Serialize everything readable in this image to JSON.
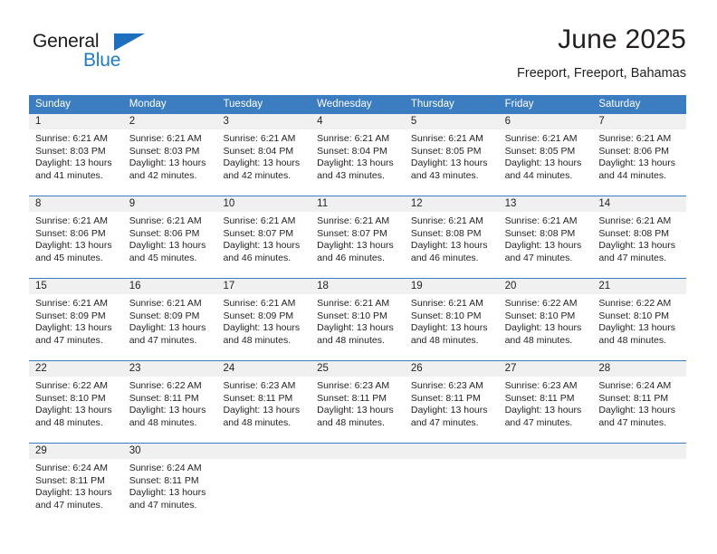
{
  "brand": {
    "name_primary": "General",
    "name_secondary": "Blue",
    "triangle_color": "#1f6fc0",
    "secondary_color": "#1f7cc4"
  },
  "header": {
    "title": "June 2025",
    "subtitle": "Freeport, Freeport, Bahamas"
  },
  "theme": {
    "header_blue": "#3c7cc0",
    "day_band_gray": "#f0f0f0",
    "text": "#231f20"
  },
  "weekdays": [
    "Sunday",
    "Monday",
    "Tuesday",
    "Wednesday",
    "Thursday",
    "Friday",
    "Saturday"
  ],
  "weeks": [
    [
      {
        "day": "1",
        "sunrise": "Sunrise: 6:21 AM",
        "sunset": "Sunset: 8:03 PM",
        "daylight1": "Daylight: 13 hours",
        "daylight2": "and 41 minutes."
      },
      {
        "day": "2",
        "sunrise": "Sunrise: 6:21 AM",
        "sunset": "Sunset: 8:03 PM",
        "daylight1": "Daylight: 13 hours",
        "daylight2": "and 42 minutes."
      },
      {
        "day": "3",
        "sunrise": "Sunrise: 6:21 AM",
        "sunset": "Sunset: 8:04 PM",
        "daylight1": "Daylight: 13 hours",
        "daylight2": "and 42 minutes."
      },
      {
        "day": "4",
        "sunrise": "Sunrise: 6:21 AM",
        "sunset": "Sunset: 8:04 PM",
        "daylight1": "Daylight: 13 hours",
        "daylight2": "and 43 minutes."
      },
      {
        "day": "5",
        "sunrise": "Sunrise: 6:21 AM",
        "sunset": "Sunset: 8:05 PM",
        "daylight1": "Daylight: 13 hours",
        "daylight2": "and 43 minutes."
      },
      {
        "day": "6",
        "sunrise": "Sunrise: 6:21 AM",
        "sunset": "Sunset: 8:05 PM",
        "daylight1": "Daylight: 13 hours",
        "daylight2": "and 44 minutes."
      },
      {
        "day": "7",
        "sunrise": "Sunrise: 6:21 AM",
        "sunset": "Sunset: 8:06 PM",
        "daylight1": "Daylight: 13 hours",
        "daylight2": "and 44 minutes."
      }
    ],
    [
      {
        "day": "8",
        "sunrise": "Sunrise: 6:21 AM",
        "sunset": "Sunset: 8:06 PM",
        "daylight1": "Daylight: 13 hours",
        "daylight2": "and 45 minutes."
      },
      {
        "day": "9",
        "sunrise": "Sunrise: 6:21 AM",
        "sunset": "Sunset: 8:06 PM",
        "daylight1": "Daylight: 13 hours",
        "daylight2": "and 45 minutes."
      },
      {
        "day": "10",
        "sunrise": "Sunrise: 6:21 AM",
        "sunset": "Sunset: 8:07 PM",
        "daylight1": "Daylight: 13 hours",
        "daylight2": "and 46 minutes."
      },
      {
        "day": "11",
        "sunrise": "Sunrise: 6:21 AM",
        "sunset": "Sunset: 8:07 PM",
        "daylight1": "Daylight: 13 hours",
        "daylight2": "and 46 minutes."
      },
      {
        "day": "12",
        "sunrise": "Sunrise: 6:21 AM",
        "sunset": "Sunset: 8:08 PM",
        "daylight1": "Daylight: 13 hours",
        "daylight2": "and 46 minutes."
      },
      {
        "day": "13",
        "sunrise": "Sunrise: 6:21 AM",
        "sunset": "Sunset: 8:08 PM",
        "daylight1": "Daylight: 13 hours",
        "daylight2": "and 47 minutes."
      },
      {
        "day": "14",
        "sunrise": "Sunrise: 6:21 AM",
        "sunset": "Sunset: 8:08 PM",
        "daylight1": "Daylight: 13 hours",
        "daylight2": "and 47 minutes."
      }
    ],
    [
      {
        "day": "15",
        "sunrise": "Sunrise: 6:21 AM",
        "sunset": "Sunset: 8:09 PM",
        "daylight1": "Daylight: 13 hours",
        "daylight2": "and 47 minutes."
      },
      {
        "day": "16",
        "sunrise": "Sunrise: 6:21 AM",
        "sunset": "Sunset: 8:09 PM",
        "daylight1": "Daylight: 13 hours",
        "daylight2": "and 47 minutes."
      },
      {
        "day": "17",
        "sunrise": "Sunrise: 6:21 AM",
        "sunset": "Sunset: 8:09 PM",
        "daylight1": "Daylight: 13 hours",
        "daylight2": "and 48 minutes."
      },
      {
        "day": "18",
        "sunrise": "Sunrise: 6:21 AM",
        "sunset": "Sunset: 8:10 PM",
        "daylight1": "Daylight: 13 hours",
        "daylight2": "and 48 minutes."
      },
      {
        "day": "19",
        "sunrise": "Sunrise: 6:21 AM",
        "sunset": "Sunset: 8:10 PM",
        "daylight1": "Daylight: 13 hours",
        "daylight2": "and 48 minutes."
      },
      {
        "day": "20",
        "sunrise": "Sunrise: 6:22 AM",
        "sunset": "Sunset: 8:10 PM",
        "daylight1": "Daylight: 13 hours",
        "daylight2": "and 48 minutes."
      },
      {
        "day": "21",
        "sunrise": "Sunrise: 6:22 AM",
        "sunset": "Sunset: 8:10 PM",
        "daylight1": "Daylight: 13 hours",
        "daylight2": "and 48 minutes."
      }
    ],
    [
      {
        "day": "22",
        "sunrise": "Sunrise: 6:22 AM",
        "sunset": "Sunset: 8:10 PM",
        "daylight1": "Daylight: 13 hours",
        "daylight2": "and 48 minutes."
      },
      {
        "day": "23",
        "sunrise": "Sunrise: 6:22 AM",
        "sunset": "Sunset: 8:11 PM",
        "daylight1": "Daylight: 13 hours",
        "daylight2": "and 48 minutes."
      },
      {
        "day": "24",
        "sunrise": "Sunrise: 6:23 AM",
        "sunset": "Sunset: 8:11 PM",
        "daylight1": "Daylight: 13 hours",
        "daylight2": "and 48 minutes."
      },
      {
        "day": "25",
        "sunrise": "Sunrise: 6:23 AM",
        "sunset": "Sunset: 8:11 PM",
        "daylight1": "Daylight: 13 hours",
        "daylight2": "and 48 minutes."
      },
      {
        "day": "26",
        "sunrise": "Sunrise: 6:23 AM",
        "sunset": "Sunset: 8:11 PM",
        "daylight1": "Daylight: 13 hours",
        "daylight2": "and 47 minutes."
      },
      {
        "day": "27",
        "sunrise": "Sunrise: 6:23 AM",
        "sunset": "Sunset: 8:11 PM",
        "daylight1": "Daylight: 13 hours",
        "daylight2": "and 47 minutes."
      },
      {
        "day": "28",
        "sunrise": "Sunrise: 6:24 AM",
        "sunset": "Sunset: 8:11 PM",
        "daylight1": "Daylight: 13 hours",
        "daylight2": "and 47 minutes."
      }
    ],
    [
      {
        "day": "29",
        "sunrise": "Sunrise: 6:24 AM",
        "sunset": "Sunset: 8:11 PM",
        "daylight1": "Daylight: 13 hours",
        "daylight2": "and 47 minutes."
      },
      {
        "day": "30",
        "sunrise": "Sunrise: 6:24 AM",
        "sunset": "Sunset: 8:11 PM",
        "daylight1": "Daylight: 13 hours",
        "daylight2": "and 47 minutes."
      },
      {
        "day": "",
        "sunrise": "",
        "sunset": "",
        "daylight1": "",
        "daylight2": ""
      },
      {
        "day": "",
        "sunrise": "",
        "sunset": "",
        "daylight1": "",
        "daylight2": ""
      },
      {
        "day": "",
        "sunrise": "",
        "sunset": "",
        "daylight1": "",
        "daylight2": ""
      },
      {
        "day": "",
        "sunrise": "",
        "sunset": "",
        "daylight1": "",
        "daylight2": ""
      },
      {
        "day": "",
        "sunrise": "",
        "sunset": "",
        "daylight1": "",
        "daylight2": ""
      }
    ]
  ]
}
